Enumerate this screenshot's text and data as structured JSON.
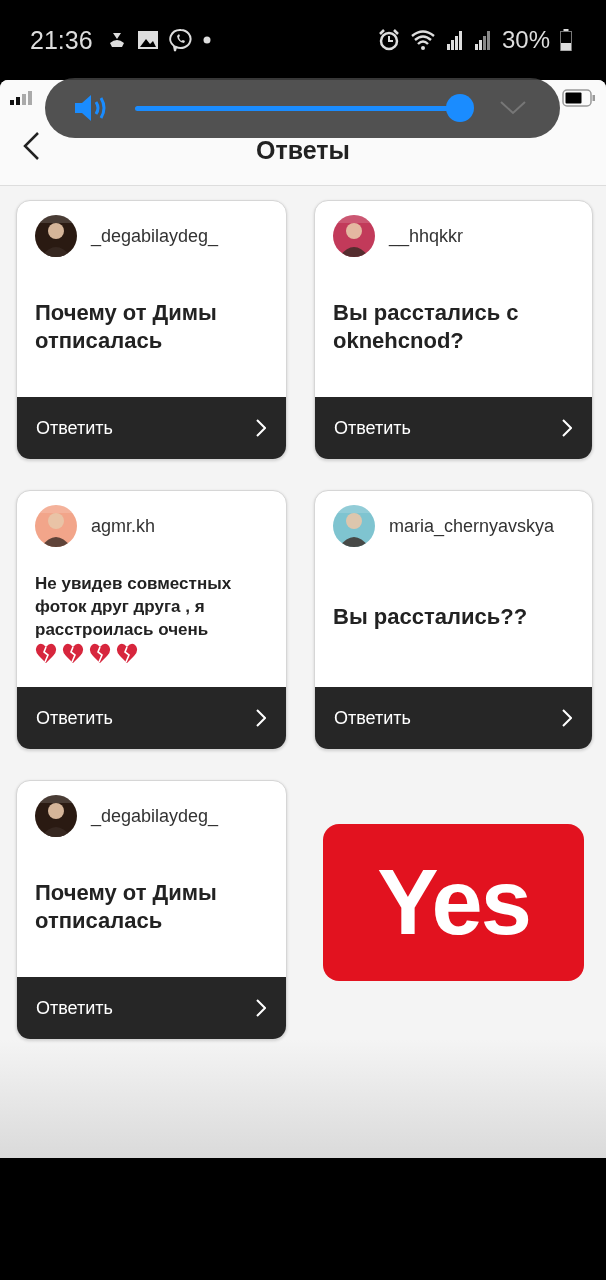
{
  "phone_status": {
    "time": "21:36",
    "battery": "30%"
  },
  "volume": {
    "level": 1
  },
  "nav": {
    "title": "Ответы"
  },
  "cards": [
    {
      "kind": "question",
      "username": "_degabilaydeg_",
      "text": "Почему от Димы отписалась",
      "reply": "Ответить"
    },
    {
      "kind": "question",
      "username": "__hhqkkr",
      "text": "Вы расстались с oknehcnod?",
      "reply": "Ответить"
    },
    {
      "kind": "long_question",
      "username": "agmr.kh",
      "text": "Не увидев совместных фоток  друг друга , я расстроилась очень",
      "reply": "Ответить"
    },
    {
      "kind": "question",
      "username": "maria_chernyavskya",
      "text": "Вы расстались??",
      "reply": "Ответить"
    },
    {
      "kind": "question",
      "username": "_degabilaydeg_",
      "text": "Почему от Димы отписалась",
      "reply": "Ответить"
    },
    {
      "kind": "sticker",
      "text": "Yes"
    }
  ]
}
